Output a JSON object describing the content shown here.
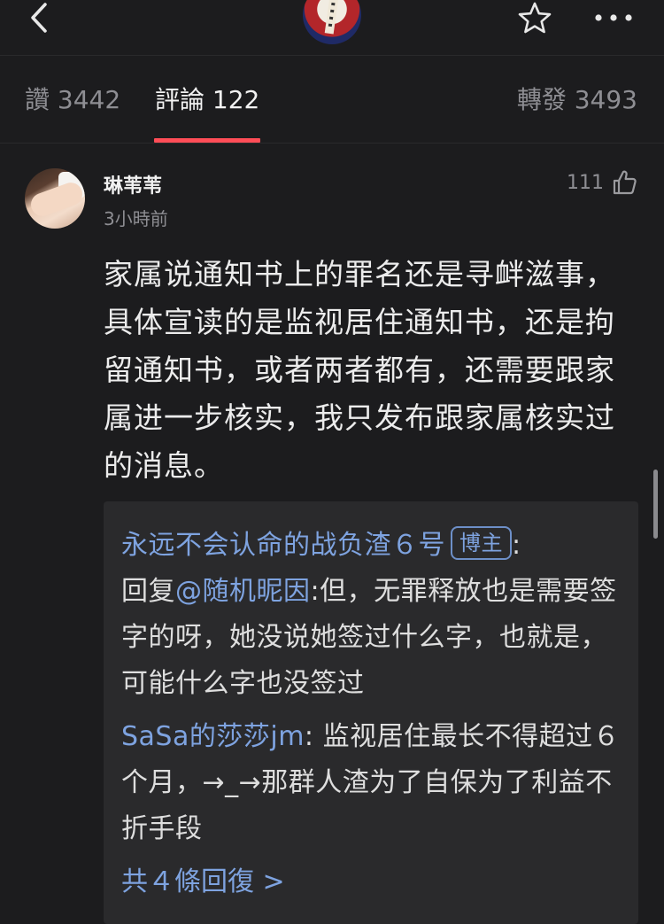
{
  "nav": {
    "back_icon": "chevron-left-icon",
    "avatar": "profile-avatar",
    "star_icon": "star-outline-icon",
    "more_icon": "more-horizontal-icon"
  },
  "tabs": {
    "likes": "讚 3442",
    "comments": "評論 122",
    "reposts": "轉發 3493",
    "active_color": "#ff4d57"
  },
  "comment": {
    "username": "琳苇苇",
    "time": "3小時前",
    "likes": "111",
    "like_icon": "thumbs-up-outline-icon",
    "text": "家属说通知书上的罪名还是寻衅滋事，具体宣读的是监视居住通知书，还是拘留通知书，或者两者都有，还需要跟家属进一步核实，我只发布跟家属核实过的消息。"
  },
  "replies": {
    "items": [
      {
        "author": "永远不会认命的战负渣６号",
        "badge": "博主",
        "separator": ":",
        "prefix": "回复",
        "mention": "@随机昵因",
        "text": ":但，无罪释放也是需要签字的呀，她没说她签过什么字，也就是，可能什么字也没签过"
      },
      {
        "author": "SaSa的莎莎jm",
        "separator": ":",
        "text": " 监视居住最长不得超过６个月，→_→那群人渣为了自保为了利益不折手段"
      }
    ],
    "view_all": "共４條回復 >",
    "link_color": "#7ea3e0"
  }
}
